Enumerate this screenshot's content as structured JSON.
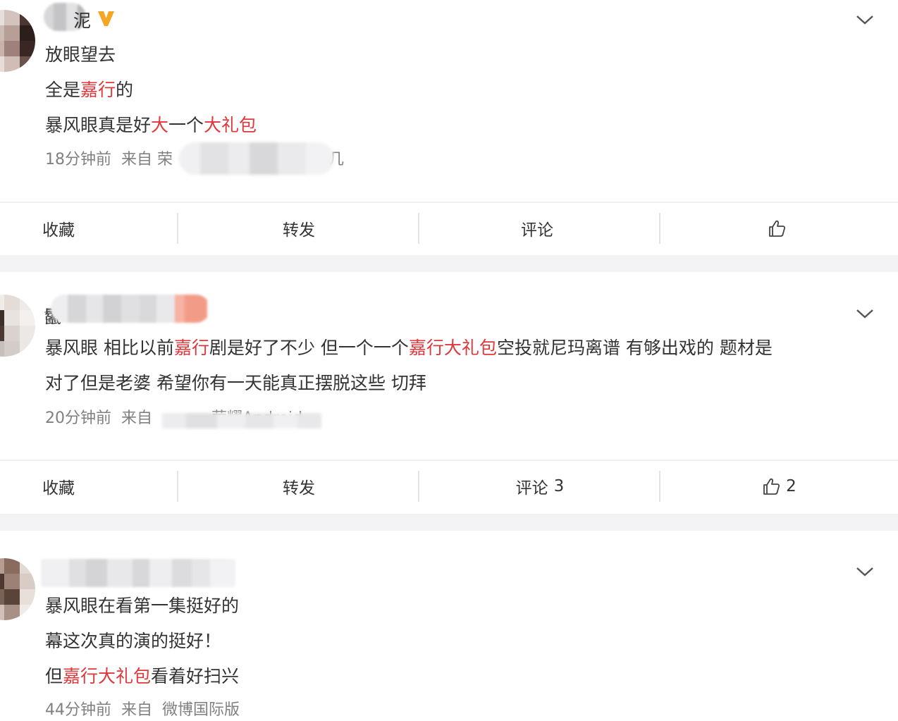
{
  "posts": [
    {
      "username_visible_suffix": "泥",
      "verified": true,
      "content_lines": [
        [
          {
            "t": "放眼望去",
            "h": false
          }
        ],
        [
          {
            "t": "全是",
            "h": false
          },
          {
            "t": "嘉行",
            "h": true
          },
          {
            "t": "的",
            "h": false
          }
        ],
        [
          {
            "t": "暴风眼真是好",
            "h": false
          },
          {
            "t": "大",
            "h": true
          },
          {
            "t": "一个",
            "h": false
          },
          {
            "t": "大礼包",
            "h": true
          }
        ]
      ],
      "time": "18分钟前",
      "source_prefix": "来自 荣",
      "source_suffix": "几",
      "actions": {
        "favorite": "收藏",
        "repost": "转发",
        "comment": "评论",
        "comment_count": "",
        "like_count": ""
      }
    },
    {
      "username_visible_prefix": "鬣",
      "verified": false,
      "content_lines": [
        [
          {
            "t": "暴风眼 相比以前",
            "h": false
          },
          {
            "t": "嘉行",
            "h": true
          },
          {
            "t": "剧是好了不少 但一个一个",
            "h": false
          },
          {
            "t": "嘉行大礼包",
            "h": true
          },
          {
            "t": "空投就尼玛离谱 有够出戏的 题材是",
            "h": false
          }
        ],
        [
          {
            "t": "对了但是老婆 希望你有一天能真正摆脱这些 切拜",
            "h": false
          }
        ]
      ],
      "time": "20分钟前",
      "source_prefix": "来自",
      "source_suffix": "荣耀Android",
      "actions": {
        "favorite": "收藏",
        "repost": "转发",
        "comment": "评论",
        "comment_count": "3",
        "like_count": "2"
      }
    },
    {
      "verified": false,
      "content_lines": [
        [
          {
            "t": "暴风眼在看第一集挺好的",
            "h": false
          }
        ],
        [
          {
            "t": "幕这次真的演的挺好！",
            "h": false
          }
        ],
        [
          {
            "t": "但",
            "h": false
          },
          {
            "t": "嘉行大礼包",
            "h": true
          },
          {
            "t": "看着好扫兴",
            "h": false
          }
        ]
      ],
      "time": "44分钟前",
      "source_prefix": "来自",
      "source_suffix": "微博国际版"
    }
  ],
  "colors": {
    "highlight": "#e0373a",
    "text": "#333333",
    "meta": "#808080",
    "separator": "#f3f3f5",
    "verified": "#f5a623"
  },
  "icons": {
    "verified": "verified-v-icon",
    "expand": "chevron-down-icon",
    "like": "thumbs-up-icon"
  }
}
